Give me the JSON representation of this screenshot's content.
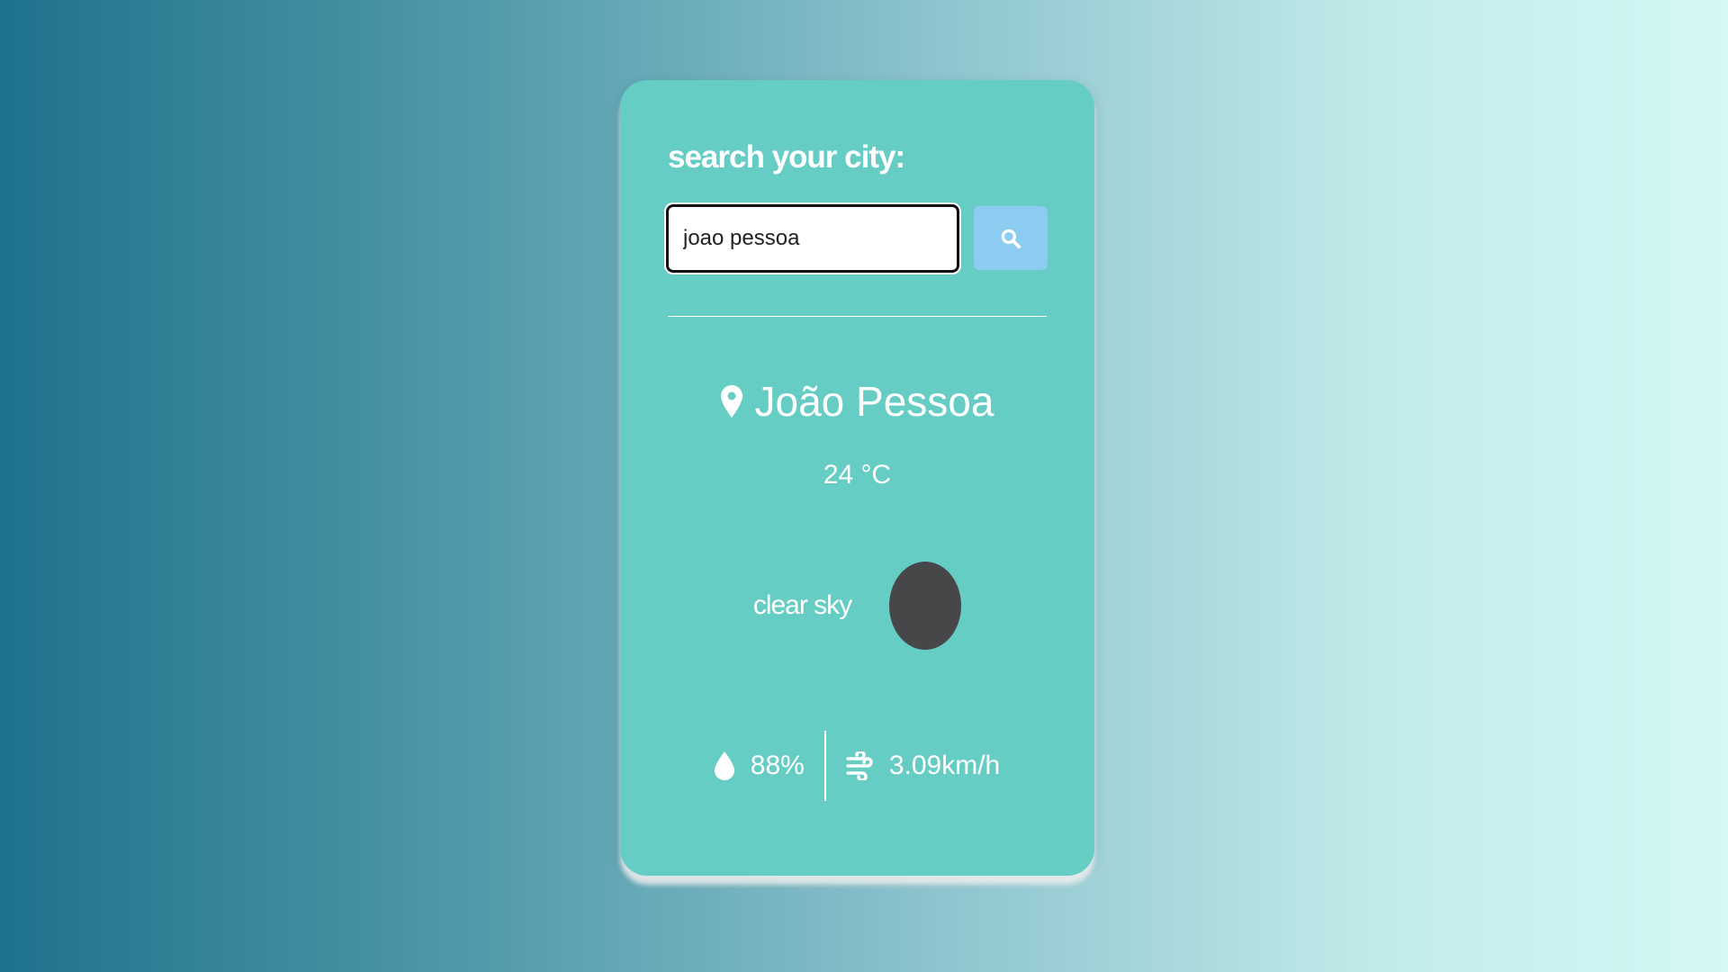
{
  "search": {
    "title": "search your city:",
    "input_value": "joao pessoa",
    "button_icon": "search-icon"
  },
  "weather": {
    "city": "João Pessoa",
    "location_icon": "map-pin-icon",
    "temperature": "24 °C",
    "description": "clear sky",
    "condition_icon": "weather-condition-icon",
    "humidity": "88%",
    "humidity_icon": "water-drop-icon",
    "wind": "3.09km/h",
    "wind_icon": "wind-icon"
  },
  "colors": {
    "card": "#66cdc4",
    "search_button": "#8dccf1",
    "weather_icon": "#474749",
    "text": "#ffffff"
  }
}
